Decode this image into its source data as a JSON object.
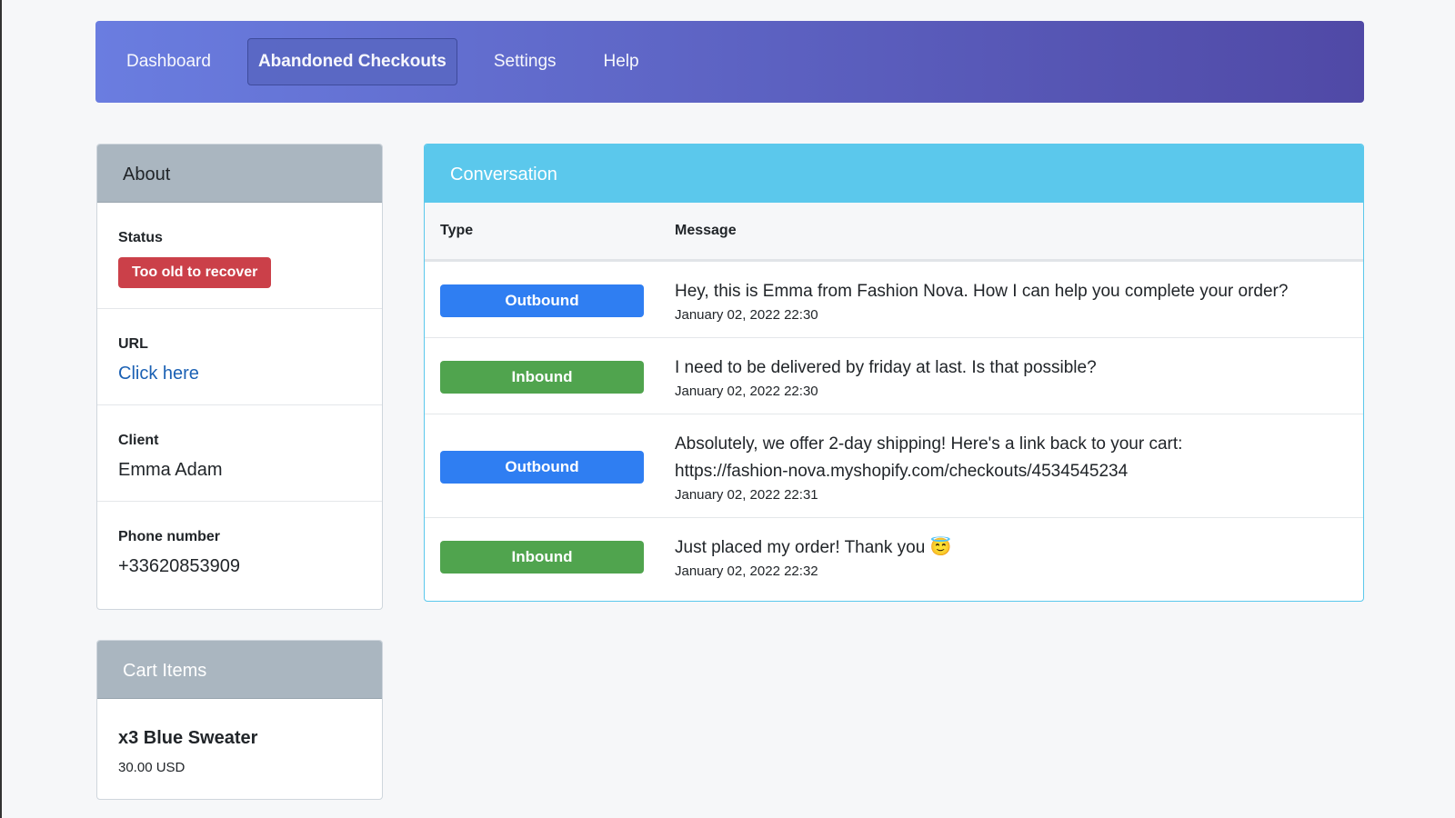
{
  "nav": {
    "items": [
      {
        "label": "Dashboard"
      },
      {
        "label": "Abandoned Checkouts",
        "active": true
      },
      {
        "label": "Settings"
      },
      {
        "label": "Help"
      }
    ]
  },
  "about": {
    "title": "About",
    "status_label": "Status",
    "status_value": "Too old to recover",
    "url_label": "URL",
    "url_link": "Click here",
    "client_label": "Client",
    "client_value": "Emma Adam",
    "phone_label": "Phone number",
    "phone_value": "+33620853909"
  },
  "cart": {
    "title": "Cart Items",
    "items": [
      {
        "name": "x3 Blue Sweater",
        "price": "30.00 USD"
      }
    ]
  },
  "conversation": {
    "title": "Conversation",
    "headers": [
      "Type",
      "Message"
    ],
    "rows": [
      {
        "type": "Outbound",
        "message": "Hey, this is Emma from Fashion Nova. How I can help you complete your order?",
        "time": "January 02, 2022 22:30"
      },
      {
        "type": "Inbound",
        "message": "I need to be delivered by friday at last. Is that possible?",
        "time": "January 02, 2022 22:30"
      },
      {
        "type": "Outbound",
        "message": "Absolutely, we offer 2-day shipping! Here's a link back to your cart: https://fashion-nova.myshopify.com/checkouts/4534545234",
        "time": "January 02, 2022 22:31"
      },
      {
        "type": "Inbound",
        "message": "Just placed my order! Thank you 😇",
        "time": "January 02, 2022 22:32"
      }
    ]
  },
  "colors": {
    "outbound": "#2f7ef2",
    "inbound": "#50a44e",
    "danger": "#cb4049",
    "info": "#5bc8ec"
  }
}
